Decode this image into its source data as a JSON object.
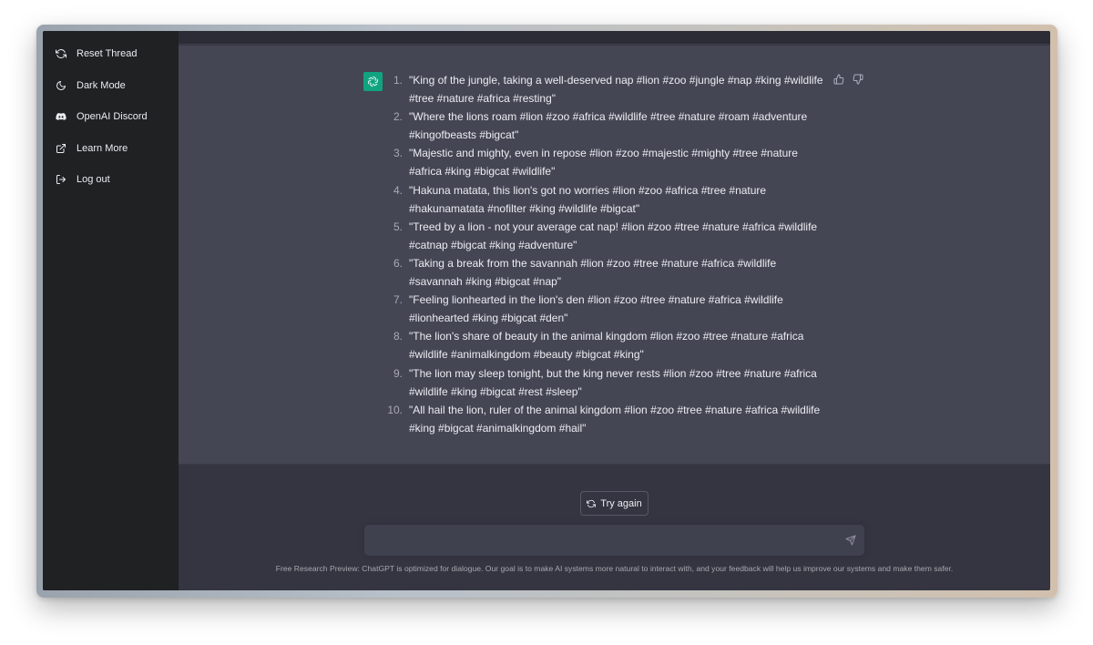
{
  "sidebar": {
    "items": [
      {
        "label": "Reset Thread",
        "icon": "refresh-icon"
      },
      {
        "label": "Dark Mode",
        "icon": "moon-icon"
      },
      {
        "label": "OpenAI Discord",
        "icon": "discord-icon"
      },
      {
        "label": "Learn More",
        "icon": "external-link-icon"
      },
      {
        "label": "Log out",
        "icon": "logout-icon"
      }
    ]
  },
  "conversation": {
    "assistant_avatar_icon": "openai-logo-icon",
    "items": [
      {
        "num": "1.",
        "text": "\"King of the jungle, taking a well-deserved nap #lion #zoo #jungle #nap #king #wildlife #tree #nature #africa #resting\""
      },
      {
        "num": "2.",
        "text": "\"Where the lions roam #lion #zoo #africa #wildlife #tree #nature #roam #adventure #kingofbeasts #bigcat\""
      },
      {
        "num": "3.",
        "text": "\"Majestic and mighty, even in repose #lion #zoo #majestic #mighty #tree #nature #africa #king #bigcat #wildlife\""
      },
      {
        "num": "4.",
        "text": "\"Hakuna matata, this lion's got no worries #lion #zoo #africa #tree #nature #hakunamatata #nofilter #king #wildlife #bigcat\""
      },
      {
        "num": "5.",
        "text": "\"Treed by a lion - not your average cat nap! #lion #zoo #tree #nature #africa #wildlife #catnap #bigcat #king #adventure\""
      },
      {
        "num": "6.",
        "text": "\"Taking a break from the savannah #lion #zoo #tree #nature #africa #wildlife #savannah #king #bigcat #nap\""
      },
      {
        "num": "7.",
        "text": "\"Feeling lionhearted in the lion's den #lion #zoo #tree #nature #africa #wildlife #lionhearted #king #bigcat #den\""
      },
      {
        "num": "8.",
        "text": "\"The lion's share of beauty in the animal kingdom #lion #zoo #tree #nature #africa #wildlife #animalkingdom #beauty #bigcat #king\""
      },
      {
        "num": "9.",
        "text": "\"The lion may sleep tonight, but the king never rests #lion #zoo #tree #nature #africa #wildlife #king #bigcat #rest #sleep\""
      },
      {
        "num": "10.",
        "text": "\"All hail the lion, ruler of the animal kingdom #lion #zoo #tree #nature #africa #wildlife #king #bigcat #animalkingdom #hail\""
      }
    ]
  },
  "actions": {
    "try_again_label": "Try again"
  },
  "composer": {
    "value": "",
    "placeholder": ""
  },
  "footer": {
    "disclaimer": "Free Research Preview: ChatGPT is optimized for dialogue. Our goal is to make AI systems more natural to interact with, and your feedback will help us improve our systems and make them safer."
  },
  "colors": {
    "sidebar_bg": "#202123",
    "main_bg": "#343541",
    "assistant_bg": "#444654",
    "accent": "#10a37f",
    "text": "#ececf1"
  }
}
